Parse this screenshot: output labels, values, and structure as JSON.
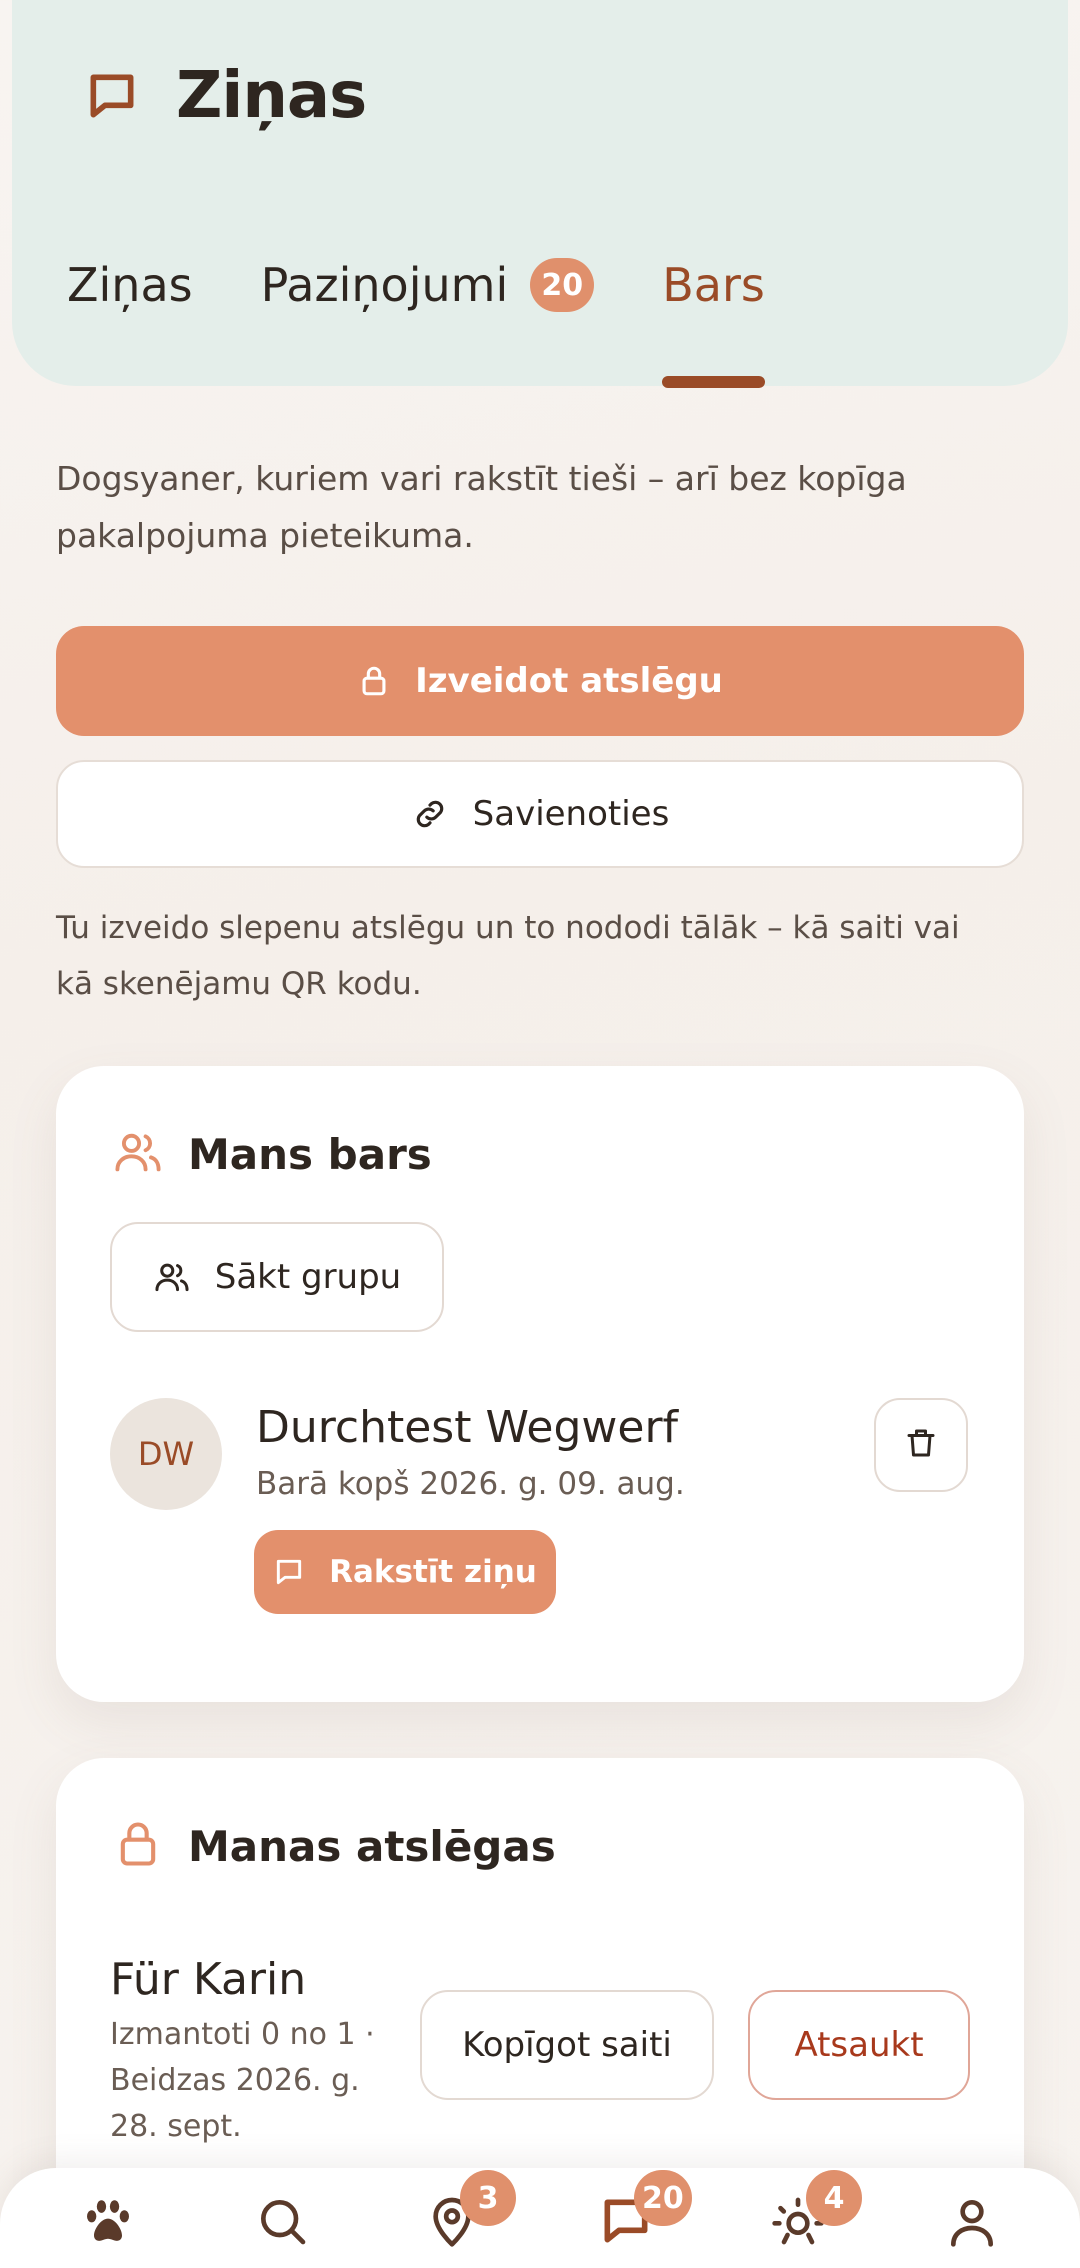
{
  "header": {
    "title": "Ziņas",
    "tabs": [
      {
        "label": "Ziņas"
      },
      {
        "label": "Paziņojumi",
        "badge": "20"
      },
      {
        "label": "Bars",
        "active": true
      }
    ]
  },
  "intro_text": "Dogsyaner, kuriem vari rakstīt tieši – arī bez kopīga pakalpojuma pieteikuma.",
  "actions": {
    "create_key_label": "Izveidot atslēgu",
    "connect_label": "Savienoties"
  },
  "note_text": "Tu izveido slepenu atslēgu un to nododi tālāk – kā saiti vai kā skenējamu QR kodu.",
  "my_pack": {
    "title": "Mans bars",
    "start_group_label": "Sākt grupu",
    "member": {
      "initials": "DW",
      "name": "Durchtest Wegwerf",
      "since": "Barā kopš 2026. g. 09. aug.",
      "write_label": "Rakstīt ziņu"
    }
  },
  "my_keys": {
    "title": "Manas atslēgas",
    "key": {
      "name": "Für Karin",
      "meta": "Izmantoti 0 no 1 · Beidzas 2026. g. 28. sept.",
      "share_label": "Kopīgot saiti",
      "revoke_label": "Atsaukt"
    }
  },
  "bottom_nav": {
    "items": [
      {
        "icon": "paw-icon"
      },
      {
        "icon": "search-icon"
      },
      {
        "icon": "map-pin-icon",
        "badge": "3"
      },
      {
        "icon": "chat-icon",
        "badge": "20",
        "active": true
      },
      {
        "icon": "sun-icon",
        "badge": "4"
      },
      {
        "icon": "profile-icon"
      }
    ]
  },
  "colors": {
    "accent": "#e3906c",
    "brand_brown": "#9a4b27",
    "header_bg": "#e4eeea",
    "danger": "#a8391c"
  }
}
